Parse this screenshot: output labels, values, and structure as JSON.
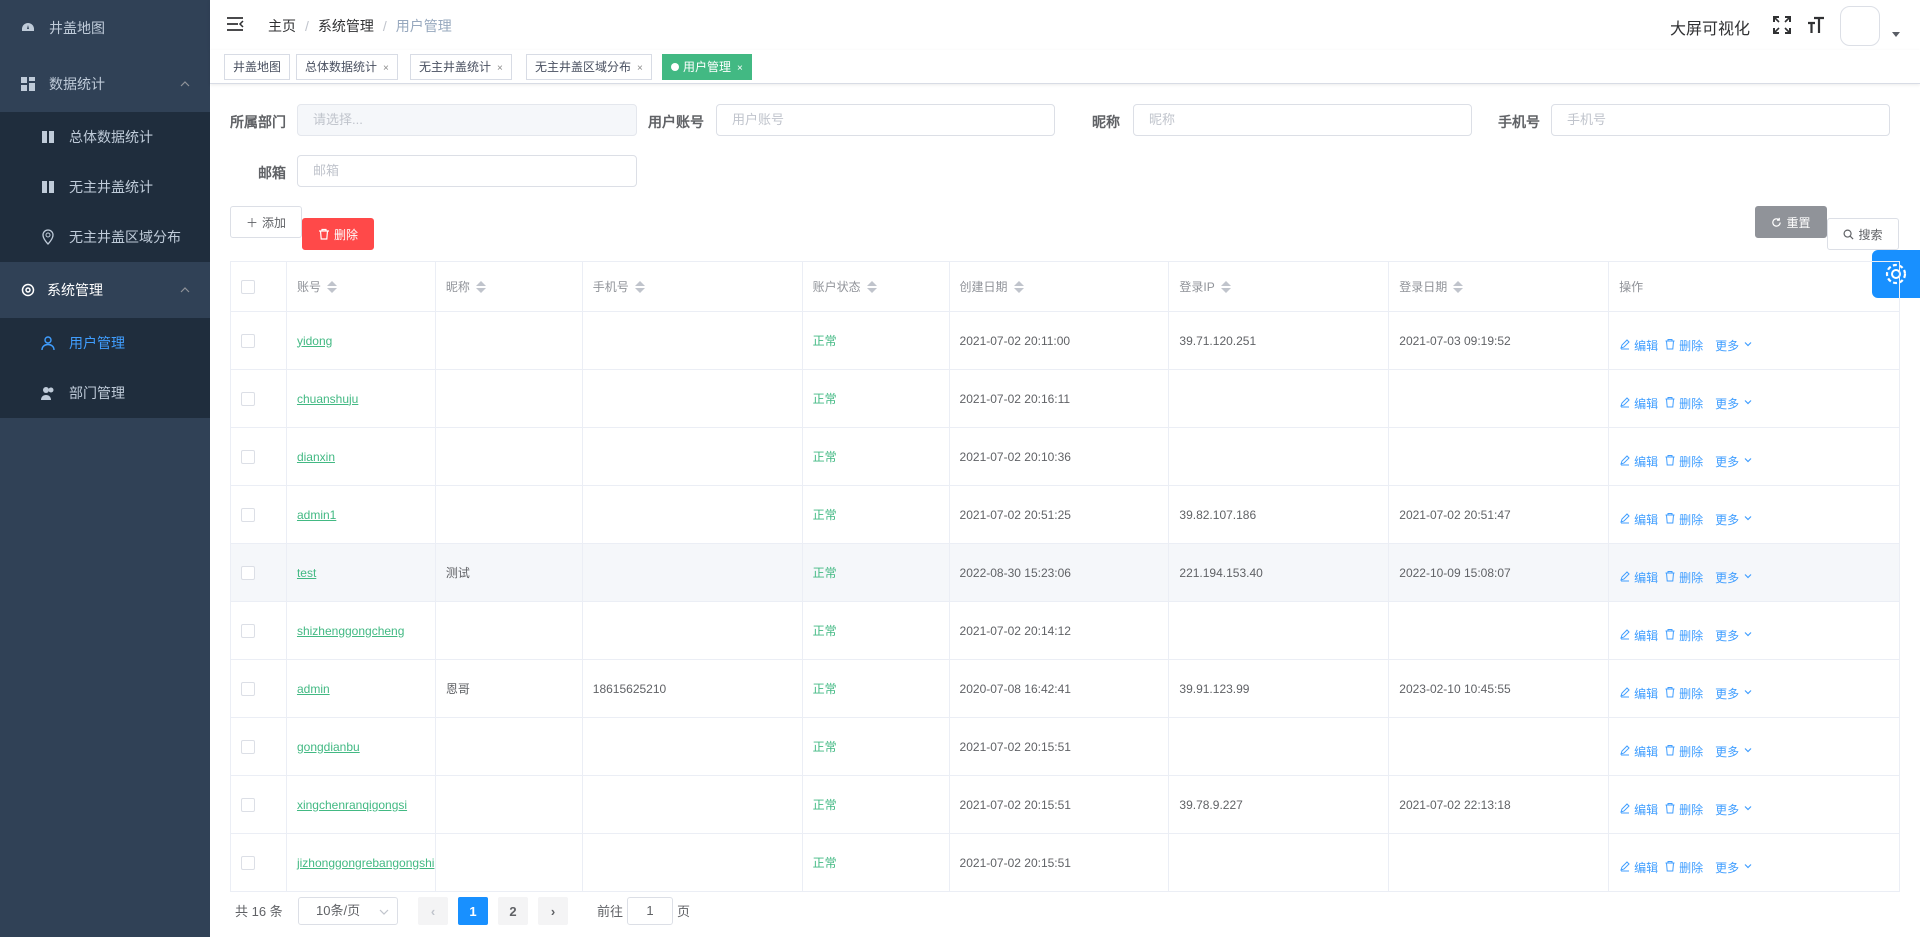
{
  "sidebar": {
    "items": [
      {
        "label": "井盖地图",
        "icon": "dashboard-icon"
      },
      {
        "label": "数据统计",
        "icon": "grid-icon"
      },
      {
        "label": "总体数据统计",
        "icon": "book-icon"
      },
      {
        "label": "无主井盖统计",
        "icon": "book-icon"
      },
      {
        "label": "无主井盖区域分布",
        "icon": "location-icon"
      },
      {
        "label": "系统管理",
        "icon": "gear-icon"
      },
      {
        "label": "用户管理",
        "icon": "user-icon"
      },
      {
        "label": "部门管理",
        "icon": "peoples-icon"
      }
    ]
  },
  "navbar": {
    "breadcrumb": [
      "主页",
      "系统管理",
      "用户管理"
    ],
    "big_screen": "大屏可视化"
  },
  "tags": [
    "井盖地图",
    "总体数据统计",
    "无主井盖统计",
    "无主井盖区域分布",
    "用户管理"
  ],
  "search": {
    "dept_label": "所属部门",
    "dept_placeholder": "请选择...",
    "account_label": "用户账号",
    "account_placeholder": "用户账号",
    "nickname_label": "昵称",
    "nickname_placeholder": "昵称",
    "phone_label": "手机号",
    "phone_placeholder": "手机号",
    "email_label": "邮箱",
    "email_placeholder": "邮箱"
  },
  "toolbar": {
    "add_label": "添加",
    "delete_label": "删除",
    "reset_label": "重置",
    "search_label": "搜索"
  },
  "table": {
    "columns": [
      "账号",
      "昵称",
      "手机号",
      "账户状态",
      "创建日期",
      "登录IP",
      "登录日期",
      "操作"
    ],
    "ops": {
      "edit": "编辑",
      "delete": "删除",
      "more": "更多"
    },
    "rows": [
      {
        "account": "yidong",
        "nickname": "",
        "phone": "",
        "status": "正常",
        "created": "2021-07-02 20:11:00",
        "ip": "39.71.120.251",
        "login": "2021-07-03 09:19:52"
      },
      {
        "account": "chuanshuju",
        "nickname": "",
        "phone": "",
        "status": "正常",
        "created": "2021-07-02 20:16:11",
        "ip": "",
        "login": ""
      },
      {
        "account": "dianxin",
        "nickname": "",
        "phone": "",
        "status": "正常",
        "created": "2021-07-02 20:10:36",
        "ip": "",
        "login": ""
      },
      {
        "account": "admin1",
        "nickname": "",
        "phone": "",
        "status": "正常",
        "created": "2021-07-02 20:51:25",
        "ip": "39.82.107.186",
        "login": "2021-07-02 20:51:47"
      },
      {
        "account": "test",
        "nickname": "测试",
        "phone": "",
        "status": "正常",
        "created": "2022-08-30 15:23:06",
        "ip": "221.194.153.40",
        "login": "2022-10-09 15:08:07"
      },
      {
        "account": "shizhenggongcheng",
        "nickname": "",
        "phone": "",
        "status": "正常",
        "created": "2021-07-02 20:14:12",
        "ip": "",
        "login": ""
      },
      {
        "account": "admin",
        "nickname": "恩哥",
        "phone": "18615625210",
        "status": "正常",
        "created": "2020-07-08 16:42:41",
        "ip": "39.91.123.99",
        "login": "2023-02-10 10:45:55"
      },
      {
        "account": "gongdianbu",
        "nickname": "",
        "phone": "",
        "status": "正常",
        "created": "2021-07-02 20:15:51",
        "ip": "",
        "login": ""
      },
      {
        "account": "xingchenranqigongsi",
        "nickname": "",
        "phone": "",
        "status": "正常",
        "created": "2021-07-02 20:15:51",
        "ip": "39.78.9.227",
        "login": "2021-07-02 22:13:18"
      },
      {
        "account": "jizhonggongrebangongshi",
        "nickname": "",
        "phone": "",
        "status": "正常",
        "created": "2021-07-02 20:15:51",
        "ip": "",
        "login": ""
      }
    ]
  },
  "pagination": {
    "total": "共 16 条",
    "page_size": "10条/页",
    "pages": [
      "1",
      "2"
    ],
    "goto_prefix": "前往",
    "goto_value": "1",
    "goto_suffix": "页"
  },
  "colors": {
    "sidebar": "#304156",
    "active": "#409eff",
    "success": "#42b983",
    "danger": "#ff4949"
  }
}
